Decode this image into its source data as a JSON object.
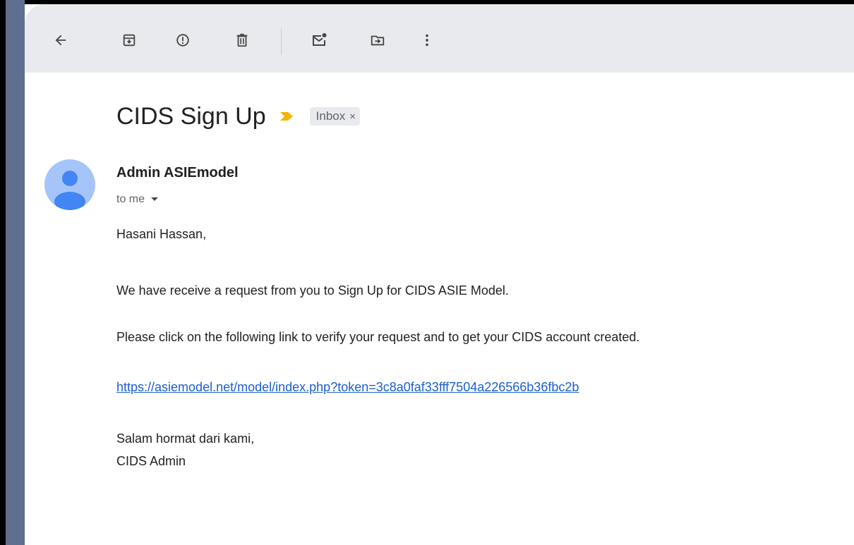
{
  "toolbar": {
    "buttons": [
      {
        "name": "back-button",
        "icon": "arrow-left-icon"
      },
      {
        "name": "archive-button",
        "icon": "archive-icon"
      },
      {
        "name": "report-spam-button",
        "icon": "report-icon"
      },
      {
        "name": "delete-button",
        "icon": "trash-icon"
      },
      {
        "name": "mark-unread-button",
        "icon": "mark-unread-icon"
      },
      {
        "name": "move-to-button",
        "icon": "move-to-icon"
      },
      {
        "name": "more-button",
        "icon": "more-vert-icon"
      }
    ]
  },
  "email": {
    "subject": "CIDS Sign Up",
    "label": "Inbox",
    "label_close": "×",
    "sender": "Admin ASIEmodel",
    "recipients": "to me",
    "body": {
      "greeting": "Hasani Hassan,",
      "line1": "We have receive a request from you to Sign Up for CIDS ASIE Model.",
      "line2": "Please click on the following link to verify your request and to get your CIDS account created.",
      "link": "https://asiemodel.net/model/index.php?token=3c8a0faf33fff7504a226566b36fbc2b",
      "closing": "Salam hormat dari kami,",
      "signature": "CIDS Admin"
    }
  },
  "colors": {
    "toolbar_bg": "#e8eaed",
    "importance_marker": "#f4b400",
    "link": "#1a5fd0",
    "avatar_bg": "#a5c4fa",
    "avatar_fg": "#4285f4"
  }
}
